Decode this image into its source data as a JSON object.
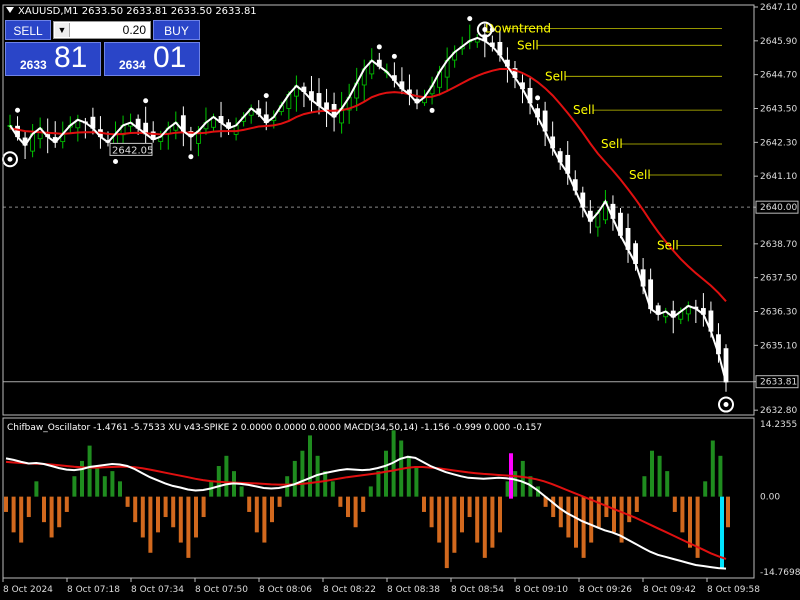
{
  "symbol_title": "XAUUSD,M1  2633.50 2633.81 2633.50 2633.81",
  "trade_panel": {
    "sell_label": "SELL",
    "buy_label": "BUY",
    "lot": "0.20",
    "sell_small": "2633",
    "sell_big": "81",
    "buy_small": "2634",
    "buy_big": "01"
  },
  "colors": {
    "background": "#000000",
    "bull_candle": "#00c800",
    "bear_candle": "#ffffff",
    "ma_fast": "#ffffff",
    "ma_slow": "#e01010",
    "signal_text": "#ffff00",
    "hist_positive": "#1f8c1f",
    "hist_negative": "#d2691e",
    "spike_magenta": "#ff00ff",
    "spike_cyan": "#00e5ff"
  },
  "chart_data": [
    {
      "type": "line",
      "title": "XAUUSD,M1  2633.50 2633.81 2633.50 2633.81",
      "price_axis_ticks": [
        "2647.10",
        "2645.90",
        "2644.70",
        "2643.50",
        "2642.30",
        "2641.10",
        "2640.00",
        "2638.70",
        "2637.50",
        "2636.30",
        "2635.10",
        "2633.81",
        "2632.80"
      ],
      "ylim": [
        2632.7,
        2647.1
      ],
      "current_price": "2633.81",
      "dashed_level": "2640.00",
      "object_label": "2642.05",
      "signals": [
        {
          "text": "Downtrend",
          "price": 2646.2
        },
        {
          "text": "Sell",
          "price": 2645.6
        },
        {
          "text": "Sell",
          "price": 2644.5
        },
        {
          "text": "Sell",
          "price": 2643.3
        },
        {
          "text": "Sell",
          "price": 2642.1
        },
        {
          "text": "Sell",
          "price": 2641.0
        },
        {
          "text": "Sell",
          "price": 2638.5
        }
      ],
      "series": [
        {
          "values": [
            2642.9,
            2642.5,
            2642.2,
            2642.6,
            2642.8,
            2642.5,
            2642.3,
            2642.6,
            2642.9,
            2643.1,
            2643.0,
            2642.8,
            2642.5,
            2642.3,
            2642.6,
            2642.9,
            2643.0,
            2642.8,
            2642.6,
            2642.4,
            2642.5,
            2642.8,
            2643.0,
            2642.7,
            2642.5,
            2642.7,
            2643.0,
            2643.2,
            2643.0,
            2642.8,
            2642.9,
            2643.2,
            2643.5,
            2643.3,
            2643.0,
            2643.2,
            2643.6,
            2644.0,
            2644.3,
            2644.1,
            2643.8,
            2643.6,
            2643.4,
            2643.2,
            2643.5,
            2643.9,
            2644.4,
            2644.9,
            2645.2,
            2645.0,
            2644.8,
            2644.5,
            2644.2,
            2644.0,
            2643.7,
            2643.9,
            2644.3,
            2644.8,
            2645.2,
            2645.5,
            2645.7,
            2645.9,
            2646.0,
            2645.9,
            2645.7,
            2645.4,
            2645.0,
            2644.6,
            2644.2,
            2643.7,
            2643.2,
            2642.7,
            2642.1,
            2641.6,
            2641.2,
            2640.6,
            2640.0,
            2639.5,
            2639.8,
            2640.2,
            2639.6,
            2639.0,
            2638.5,
            2638.0,
            2637.2,
            2636.4,
            2636.2,
            2636.3,
            2636.1,
            2636.3,
            2636.5,
            2636.4,
            2636.2,
            2635.6,
            2634.8,
            2633.8
          ]
        },
        {
          "values": [
            2642.8,
            2642.75,
            2642.7,
            2642.68,
            2642.66,
            2642.64,
            2642.62,
            2642.6,
            2642.62,
            2642.65,
            2642.66,
            2642.66,
            2642.64,
            2642.6,
            2642.58,
            2642.6,
            2642.63,
            2642.64,
            2642.62,
            2642.6,
            2642.58,
            2642.6,
            2642.64,
            2642.66,
            2642.64,
            2642.62,
            2642.64,
            2642.68,
            2642.7,
            2642.7,
            2642.7,
            2642.74,
            2642.8,
            2642.86,
            2642.88,
            2642.9,
            2642.96,
            2643.06,
            2643.2,
            2643.3,
            2643.36,
            2643.4,
            2643.42,
            2643.42,
            2643.44,
            2643.5,
            2643.6,
            2643.74,
            2643.9,
            2644.0,
            2644.06,
            2644.08,
            2644.06,
            2644.0,
            2643.94,
            2643.9,
            2643.92,
            2644.0,
            2644.12,
            2644.26,
            2644.4,
            2644.54,
            2644.66,
            2644.76,
            2644.84,
            2644.9,
            2644.9,
            2644.86,
            2644.76,
            2644.62,
            2644.44,
            2644.22,
            2643.96,
            2643.66,
            2643.34,
            2643.0,
            2642.64,
            2642.26,
            2641.9,
            2641.6,
            2641.3,
            2640.98,
            2640.64,
            2640.28,
            2639.9,
            2639.5,
            2639.12,
            2638.78,
            2638.46,
            2638.16,
            2637.9,
            2637.66,
            2637.44,
            2637.22,
            2636.96,
            2636.66
          ]
        }
      ]
    },
    {
      "type": "bar",
      "title": "Chifbaw_Oscillator -1.4761 -5.7533  XU v43-SPIKE 2 0.0000 0.0000 0.0000  MACD(34,50,14) -1.156 -0.999 0.000 -0.157",
      "axis_ticks": [
        "14.2355",
        "0.00",
        "-14.7698"
      ],
      "ylim": [
        -14.7698,
        14.2355
      ],
      "histogram": [
        -3,
        -7,
        -9,
        -4,
        3,
        -5,
        -8,
        -6,
        -3,
        4,
        7,
        10,
        6,
        4,
        5,
        3,
        -2,
        -5,
        -8,
        -11,
        -7,
        -4,
        -6,
        -9,
        -12,
        -8,
        -4,
        3,
        6,
        8,
        5,
        2,
        -3,
        -7,
        -9,
        -5,
        -2,
        4,
        7,
        9,
        12,
        8,
        5,
        3,
        -2,
        -4,
        -6,
        -3,
        2,
        5,
        9,
        13,
        11,
        8,
        6,
        -3,
        -6,
        -9,
        -14,
        -11,
        -7,
        -4,
        -9,
        -12,
        -10,
        -7,
        3,
        5,
        7,
        4,
        2,
        -2,
        -4,
        -6,
        -8,
        -10,
        -12,
        -9,
        -6,
        -4,
        -7,
        -9,
        -5,
        -3,
        4,
        9,
        8,
        5,
        -3,
        -7,
        -10,
        -12,
        3,
        11,
        8,
        -6
      ],
      "series": [
        {
          "values": [
            7.5,
            7.2,
            6.8,
            6.5,
            6.6,
            6.4,
            6.0,
            5.6,
            5.3,
            5.2,
            5.4,
            5.8,
            6.0,
            6.2,
            6.4,
            6.3,
            6.0,
            5.4,
            4.6,
            3.8,
            3.2,
            2.6,
            2.1,
            1.8,
            1.4,
            1.2,
            1.3,
            1.6,
            2.0,
            2.4,
            2.6,
            2.5,
            2.3,
            2.0,
            1.7,
            1.6,
            1.7,
            2.0,
            2.4,
            3.0,
            3.6,
            4.2,
            4.6,
            4.9,
            5.2,
            5.4,
            5.3,
            5.2,
            5.3,
            5.6,
            6.0,
            6.6,
            7.4,
            7.8,
            7.6,
            6.8,
            6.0,
            5.4,
            4.8,
            4.4,
            4.0,
            3.7,
            3.6,
            3.5,
            3.6,
            3.7,
            3.6,
            3.4,
            3.0,
            2.4,
            1.4,
            0.2,
            -1.0,
            -2.2,
            -3.2,
            -4.0,
            -4.8,
            -5.4,
            -6.0,
            -6.6,
            -7.0,
            -7.6,
            -8.4,
            -9.2,
            -10.0,
            -10.8,
            -11.4,
            -11.8,
            -12.2,
            -12.6,
            -13.0,
            -13.4,
            -13.6,
            -13.8,
            -14.0,
            -14.1
          ]
        },
        {
          "values": [
            6.8,
            6.7,
            6.6,
            6.5,
            6.45,
            6.4,
            6.3,
            6.15,
            6.0,
            5.85,
            5.75,
            5.7,
            5.7,
            5.75,
            5.8,
            5.85,
            5.85,
            5.75,
            5.55,
            5.3,
            5.0,
            4.7,
            4.4,
            4.1,
            3.8,
            3.5,
            3.25,
            3.05,
            2.9,
            2.8,
            2.75,
            2.7,
            2.65,
            2.6,
            2.5,
            2.4,
            2.35,
            2.35,
            2.4,
            2.5,
            2.65,
            2.85,
            3.05,
            3.3,
            3.55,
            3.8,
            4.0,
            4.2,
            4.4,
            4.6,
            4.85,
            5.1,
            5.4,
            5.65,
            5.8,
            5.8,
            5.7,
            5.55,
            5.35,
            5.15,
            4.95,
            4.75,
            4.6,
            4.45,
            4.35,
            4.25,
            4.15,
            4.05,
            3.9,
            3.7,
            3.4,
            3.0,
            2.5,
            1.9,
            1.3,
            0.7,
            0.1,
            -0.5,
            -1.1,
            -1.7,
            -2.3,
            -2.9,
            -3.5,
            -4.1,
            -4.8,
            -5.5,
            -6.2,
            -6.9,
            -7.6,
            -8.3,
            -9.0,
            -9.7,
            -10.4,
            -11.1,
            -11.7,
            -12.2
          ]
        }
      ]
    }
  ],
  "time_axis": [
    "8 Oct 2024",
    "8 Oct 07:18",
    "8 Oct 07:34",
    "8 Oct 07:50",
    "8 Oct 08:06",
    "8 Oct 08:22",
    "8 Oct 08:38",
    "8 Oct 08:54",
    "8 Oct 09:10",
    "8 Oct 09:26",
    "8 Oct 09:42",
    "8 Oct 09:58"
  ]
}
